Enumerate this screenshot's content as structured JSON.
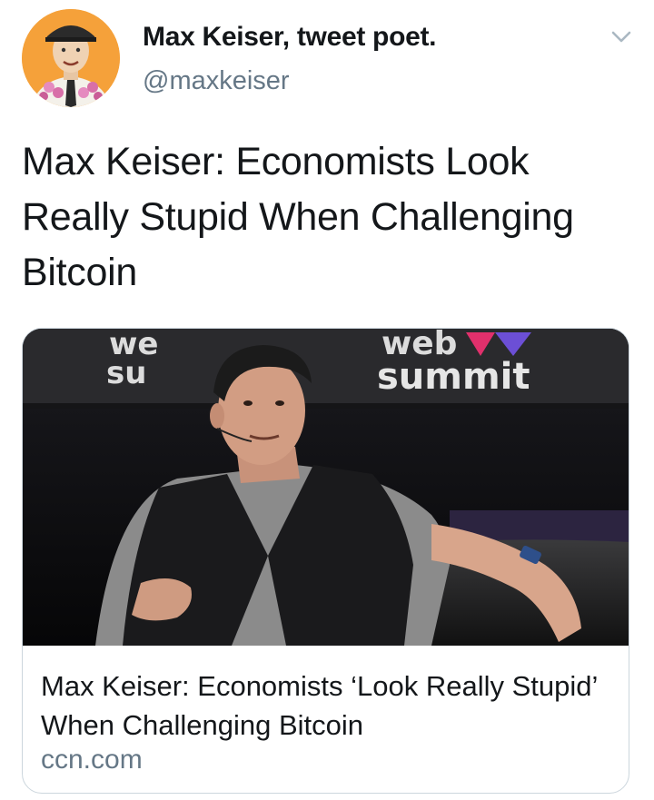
{
  "tweet": {
    "author": {
      "display_name": "Max Keiser, tweet poet.",
      "handle": "@maxkeiser",
      "avatar_icon": "caricature-avatar"
    },
    "menu_icon": "chevron-down-icon",
    "text": "Max Keiser: Economists Look Really Stupid When Challenging Bitcoin",
    "card": {
      "image_text_left": "we su",
      "image_text_right_top": "web",
      "image_text_right_bottom": "summit",
      "title": "Max Keiser: Economists ‘Look Really Stupid’ When Challenging Bitcoin",
      "domain": "ccn.com"
    }
  },
  "colors": {
    "text_primary": "#14171a",
    "text_secondary": "#657786",
    "card_border": "#ccd6dd",
    "avatar_background": "#f5a13a"
  }
}
